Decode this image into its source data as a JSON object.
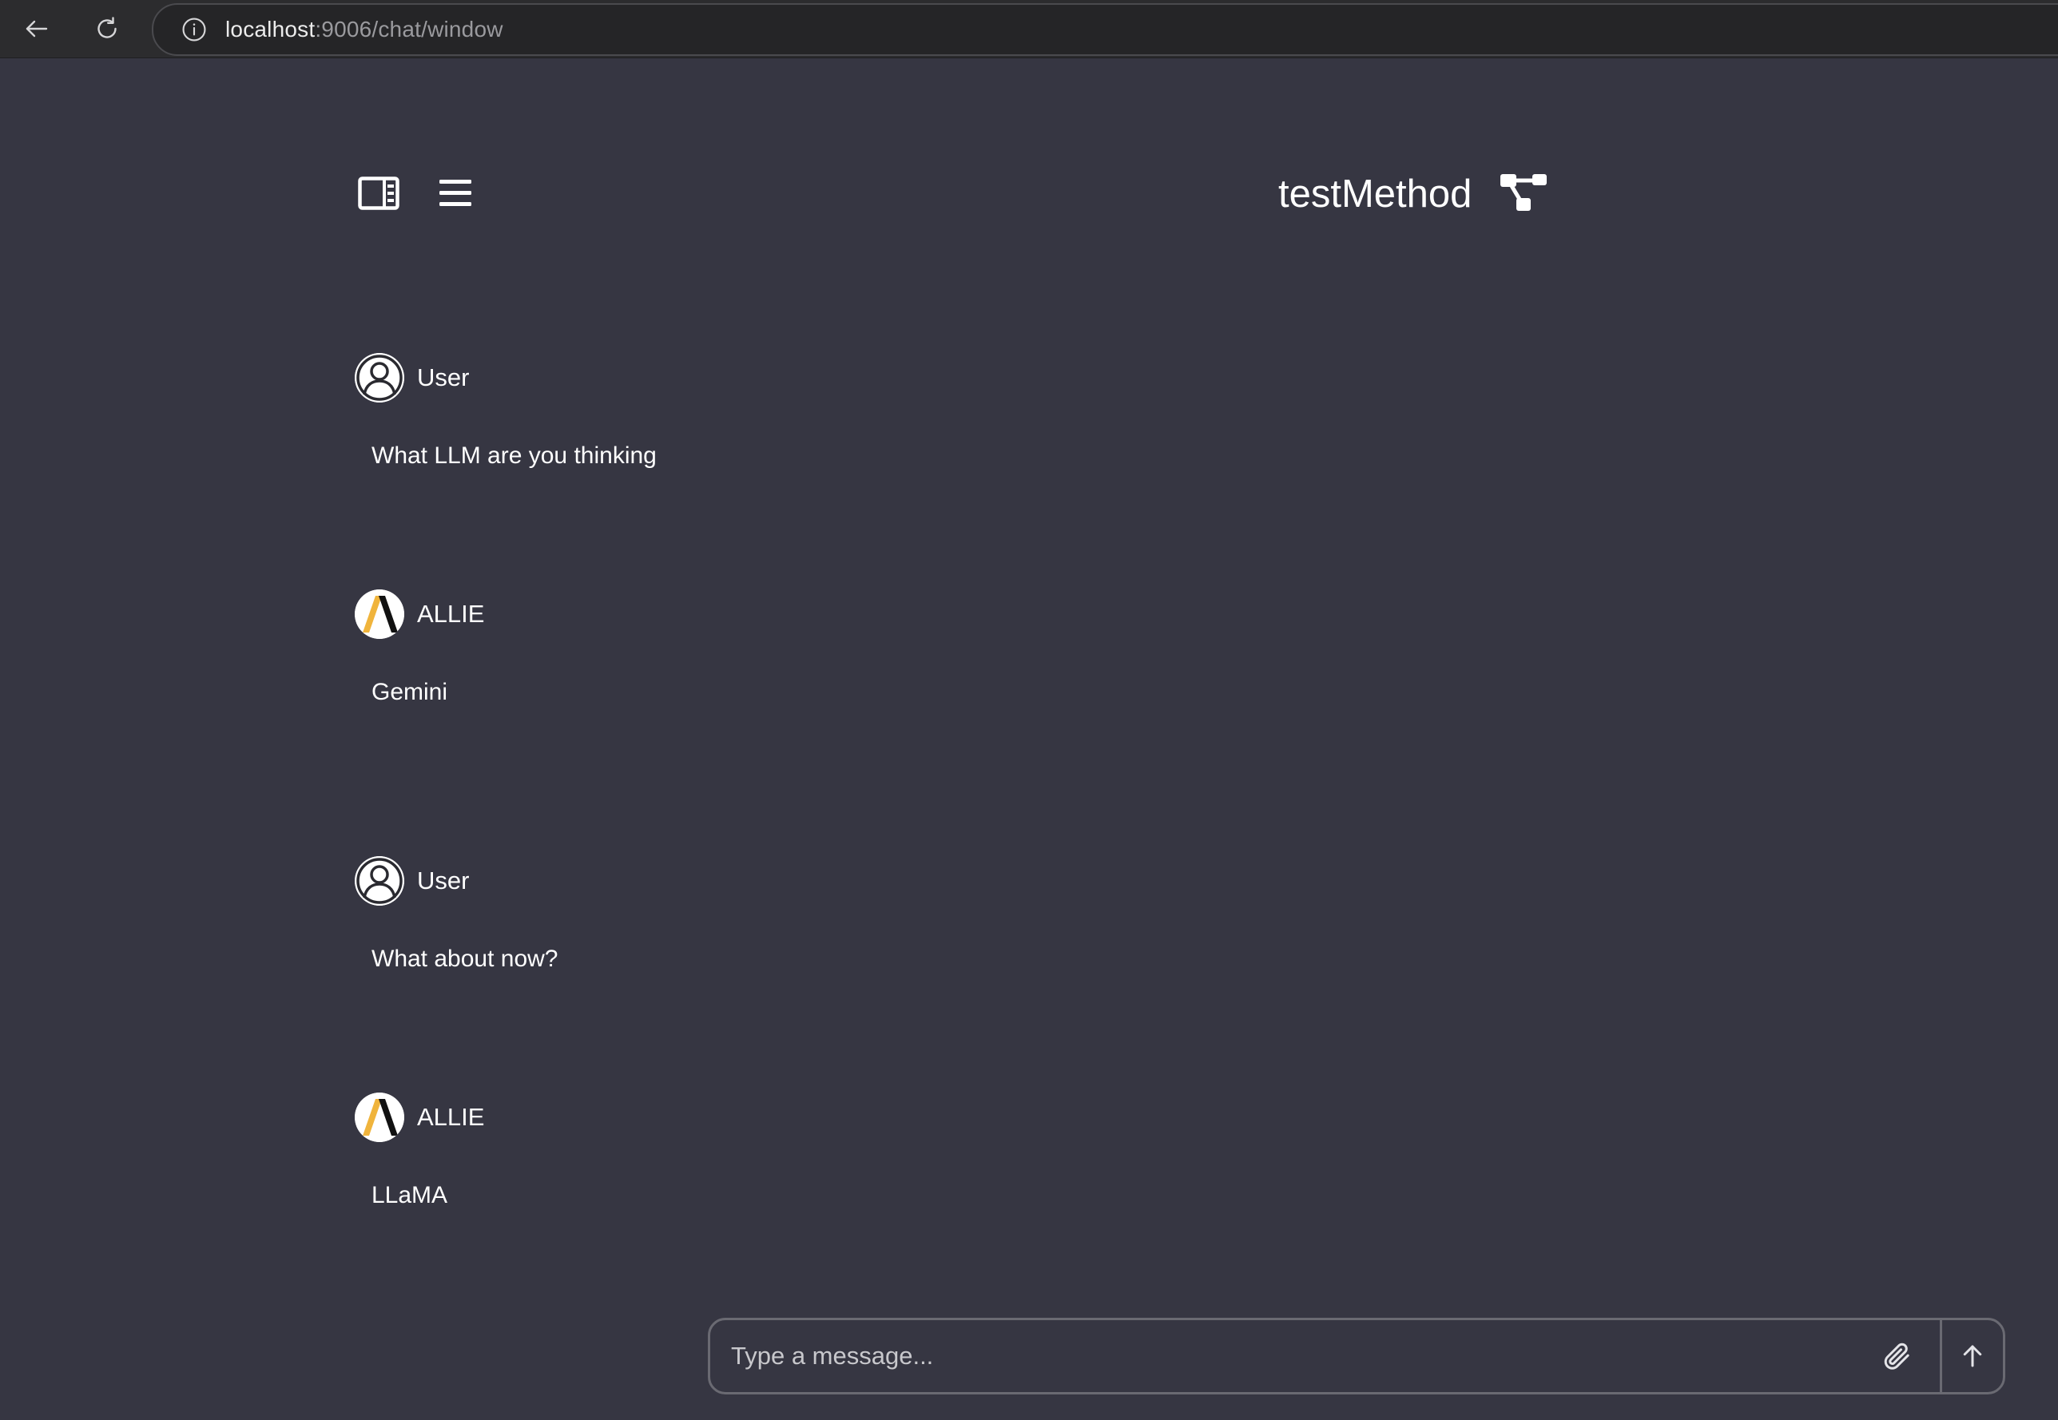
{
  "browser": {
    "url_host": "localhost",
    "url_path": ":9006/chat/window",
    "icons": {
      "back": "arrow-left-icon",
      "reload": "reload-icon",
      "info": "info-icon"
    }
  },
  "header": {
    "title": "testMethod",
    "icons": {
      "sidebar_toggle": "sidebar-panel-icon",
      "menu": "hamburger-menu-icon",
      "flow": "flow-tree-icon"
    }
  },
  "messages": [
    {
      "sender": "User",
      "text": "What LLM are you thinking",
      "avatar": "user-avatar-icon"
    },
    {
      "sender": "ALLIE",
      "text": "Gemini",
      "avatar": "allie-logo-icon"
    },
    {
      "sender": "User",
      "text": "What about now?",
      "avatar": "user-avatar-icon"
    },
    {
      "sender": "ALLIE",
      "text": "LLaMA",
      "avatar": "allie-logo-icon"
    }
  ],
  "composer": {
    "placeholder": "Type a message...",
    "value": "",
    "icons": {
      "attach": "paperclip-icon",
      "send": "arrow-up-icon"
    }
  },
  "colors": {
    "background": "#363642",
    "browser_bar": "#2c2c2e",
    "allie_accent": "#f0b43c",
    "text": "#ffffff"
  }
}
